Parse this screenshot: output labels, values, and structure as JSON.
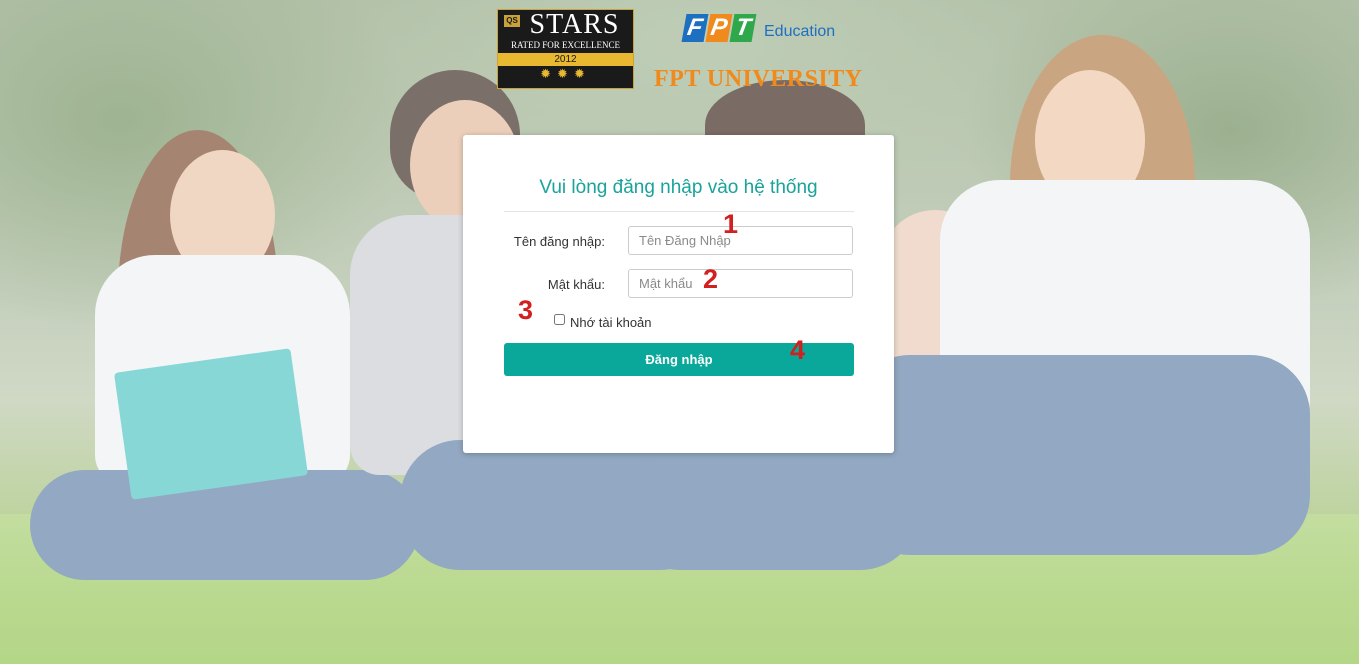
{
  "background": {
    "overlay_color": "#ffffff"
  },
  "logos": {
    "qs": {
      "tag": "QS",
      "title": "STARS",
      "subtitle": "RATED FOR EXCELLENCE",
      "year": "2012",
      "rating_glyphs": "✹✹✹"
    },
    "fpt": {
      "letters": [
        "F",
        "P",
        "T"
      ],
      "education": "Education",
      "university": "FPT UNIVERSITY"
    }
  },
  "login": {
    "title": "Vui lòng đăng nhập vào hệ thống",
    "username_label": "Tên đăng nhập:",
    "username_placeholder": "Tên Đăng Nhập",
    "username_value": "",
    "password_label": "Mật khẩu:",
    "password_placeholder": "Mật khẩu",
    "password_value": "",
    "remember_label": "Nhớ tài khoản",
    "remember_checked": false,
    "submit_label": "Đăng nhập",
    "accent_color": "#0aa89a"
  },
  "annotations": {
    "markers": [
      "1",
      "2",
      "3",
      "4"
    ],
    "color": "#d21f1f"
  }
}
